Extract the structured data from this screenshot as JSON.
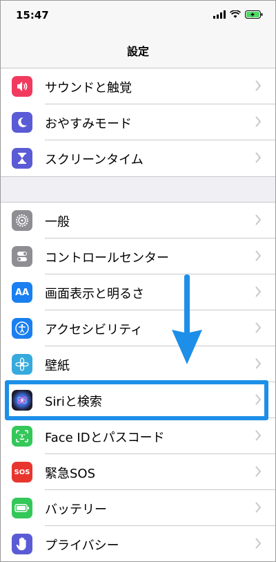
{
  "status": {
    "time": "15:47"
  },
  "nav": {
    "title": "設定"
  },
  "groups": [
    {
      "items": [
        {
          "label": "サウンドと触覚",
          "icon": "speaker-icon",
          "color": "#f23a5e"
        },
        {
          "label": "おやすみモード",
          "icon": "moon-icon",
          "color": "#5b5bd6"
        },
        {
          "label": "スクリーンタイム",
          "icon": "hourglass-icon",
          "color": "#5b5bd6"
        }
      ]
    },
    {
      "items": [
        {
          "label": "一般",
          "icon": "gear-icon",
          "color": "#8e8e93"
        },
        {
          "label": "コントロールセンター",
          "icon": "toggles-icon",
          "color": "#8e8e93"
        },
        {
          "label": "画面表示と明るさ",
          "icon": "text-size-icon",
          "color": "#1a7ff0"
        },
        {
          "label": "アクセシビリティ",
          "icon": "accessibility-icon",
          "color": "#1a7ff0"
        },
        {
          "label": "壁紙",
          "icon": "flower-icon",
          "color": "#36aadc"
        },
        {
          "label": "Siriと検索",
          "icon": "siri-icon",
          "color": "#222233"
        },
        {
          "label": "Face IDとパスコード",
          "icon": "face-id-icon",
          "color": "#34c759"
        },
        {
          "label": "緊急SOS",
          "icon": "sos-icon",
          "color": "#e8352e"
        },
        {
          "label": "バッテリー",
          "icon": "battery-icon",
          "color": "#34c759"
        },
        {
          "label": "プライバシー",
          "icon": "hand-icon",
          "color": "#5b5bd6"
        }
      ]
    }
  ],
  "icon_text": {
    "text_size": "AA",
    "sos": "SOS"
  },
  "annotation": {
    "highlight_color": "#1d8fe8",
    "highlighted_item": "Siriと検索"
  }
}
